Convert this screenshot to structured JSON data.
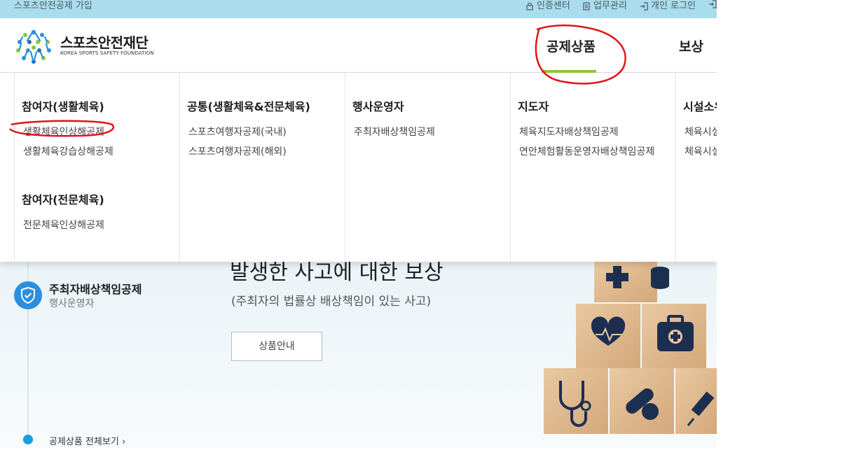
{
  "topbar": {
    "join_label": "스포츠안전공제 가입",
    "cert_center": "인증센터",
    "work_manage": "업무관리",
    "personal_login": "개인 로그인"
  },
  "logo": {
    "name": "스포츠안전재단",
    "english": "KOREA SPORTS SAFETY FOUNDATION"
  },
  "gnb": {
    "items": [
      {
        "label": "공제상품",
        "active": true
      },
      {
        "label": "보상"
      }
    ],
    "active_color": "#8cc63f"
  },
  "mega": {
    "columns": [
      {
        "heading": "참여자(생활체육)",
        "links": [
          "생활체육인상해공제",
          "생활체육강습상해공제"
        ],
        "heading2": "참여자(전문체육)",
        "links2": [
          "전문체육인상해공제"
        ]
      },
      {
        "heading": "공통(생활체육&전문체육)",
        "links": [
          "스포츠여행자공제(국내)",
          "스포츠여행자공제(해외)"
        ]
      },
      {
        "heading": "행사운영자",
        "links": [
          "주최자배상책임공제"
        ]
      },
      {
        "heading": "지도자",
        "links": [
          "체육지도자배상책임공제",
          "연안체험활동운영자배상책임공제"
        ]
      },
      {
        "heading": "시설소유",
        "links": [
          "체육시설",
          "체육시설"
        ]
      }
    ]
  },
  "hero": {
    "product_title": "주최자배상책임공제",
    "product_sub": "행사운영자",
    "headline": "발생한 사고에 대한 보상",
    "description": "(주최자의 법률상 배상책임이 있는 사고)",
    "button_label": "상품안내",
    "view_all": "공제상품 전체보기"
  },
  "colors": {
    "topbar_bg": "#a9dcec",
    "accent_green": "#8cc63f",
    "shield_blue": "#2a8fe0",
    "annotation_red": "#e0141b"
  }
}
